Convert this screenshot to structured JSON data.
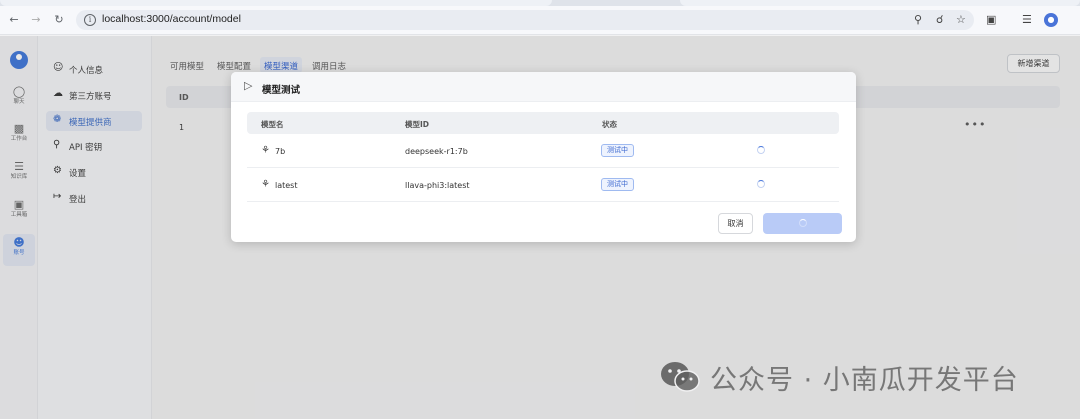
{
  "browser": {
    "url": "localhost:3000/account/model"
  },
  "rail": {
    "items": [
      {
        "label": "聊天",
        "icon": "chat-icon"
      },
      {
        "label": "工作台",
        "icon": "workbench-icon"
      },
      {
        "label": "知识库",
        "icon": "database-icon"
      },
      {
        "label": "工具箱",
        "icon": "toolbox-icon"
      },
      {
        "label": "账号",
        "icon": "user-icon",
        "active": true
      }
    ]
  },
  "subnav": {
    "items": [
      {
        "label": "个人信息",
        "icon": "user-icon"
      },
      {
        "label": "第三方账号",
        "icon": "cloud-icon"
      },
      {
        "label": "模型提供商",
        "icon": "model-icon",
        "active": true
      },
      {
        "label": "API 密钥",
        "icon": "key-icon"
      },
      {
        "label": "设置",
        "icon": "gear-icon"
      },
      {
        "label": "登出",
        "icon": "logout-icon"
      }
    ]
  },
  "main": {
    "tabs": [
      {
        "label": "可用模型"
      },
      {
        "label": "模型配置"
      },
      {
        "label": "模型渠道",
        "active": true
      },
      {
        "label": "调用日志"
      }
    ],
    "new_channel_label": "新增渠道",
    "table": {
      "id_header": "ID",
      "rows": [
        {
          "id": "1"
        }
      ]
    }
  },
  "modal": {
    "title": "模型测试",
    "headers": {
      "name": "模型名",
      "model_id": "模型ID",
      "status": "状态"
    },
    "rows": [
      {
        "name": "7b",
        "model_id": "deepseek-r1:7b",
        "status": "测试中"
      },
      {
        "name": "latest",
        "model_id": "llava-phi3:latest",
        "status": "测试中"
      }
    ],
    "cancel_label": "取消",
    "confirm_loading": true
  },
  "watermark": {
    "text": "公众号 · 小南瓜开发平台"
  },
  "colors": {
    "accent": "#3b74d9",
    "badge_text": "#3a67cf",
    "confirm_disabled": "#b9cbf7"
  }
}
